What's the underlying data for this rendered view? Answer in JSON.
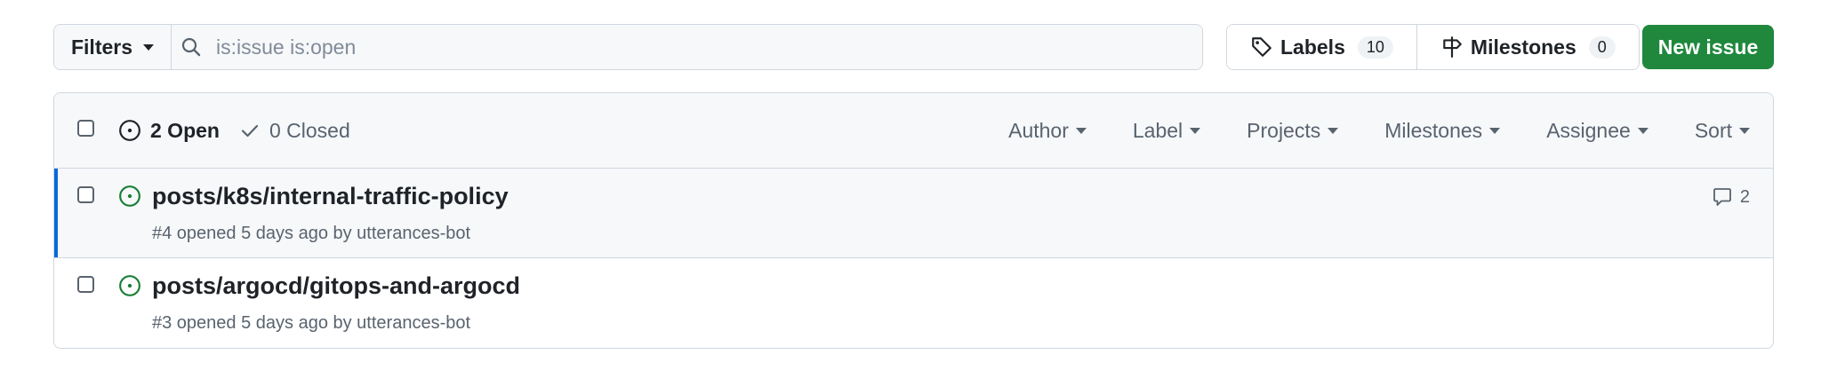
{
  "toolbar": {
    "filters_label": "Filters",
    "search_placeholder": "is:issue is:open",
    "labels_label": "Labels",
    "labels_count": "10",
    "milestones_label": "Milestones",
    "milestones_count": "0",
    "new_issue_label": "New issue"
  },
  "list_header": {
    "open_label": "2 Open",
    "closed_label": "0 Closed",
    "menus": {
      "author": "Author",
      "label": "Label",
      "projects": "Projects",
      "milestones": "Milestones",
      "assignee": "Assignee",
      "sort": "Sort"
    }
  },
  "issues": [
    {
      "title": "posts/k8s/internal-traffic-policy",
      "meta": "#4 opened 5 days ago by utterances-bot",
      "comments": "2"
    },
    {
      "title": "posts/argocd/gitops-and-argocd",
      "meta": "#3 opened 5 days ago by utterances-bot"
    }
  ],
  "colors": {
    "accent_green": "#1f883d",
    "open_icon": "#1a7f37",
    "highlight_bar": "#0969da"
  },
  "icons": [
    "search-icon",
    "tag-icon",
    "milestone-icon",
    "issue-opened-icon",
    "check-icon",
    "comment-icon",
    "caret-down-icon"
  ]
}
